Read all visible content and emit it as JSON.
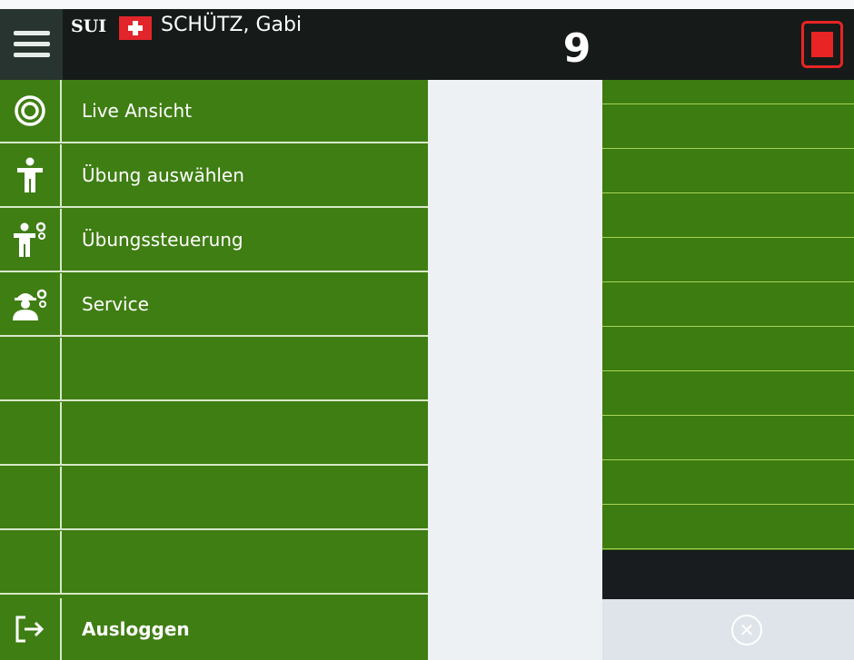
{
  "header": {
    "country_code": "SUI",
    "shooter_name": "SCHÜTZ, Gabi",
    "shot_count": "9"
  },
  "sidebar": {
    "items": [
      {
        "label": "Live Ansicht",
        "icon": "target-icon"
      },
      {
        "label": "Übung auswählen",
        "icon": "person-icon"
      },
      {
        "label": "Übungssteuerung",
        "icon": "person-gear-icon"
      },
      {
        "label": "Service",
        "icon": "worker-gear-icon"
      },
      {
        "label": ""
      },
      {
        "label": ""
      },
      {
        "label": ""
      },
      {
        "label": ""
      }
    ],
    "logout_label": "Ausloggen"
  },
  "colors": {
    "header_bg": "#161b1a",
    "sidebar_green": "#3f7e13",
    "stop_red": "#e82424",
    "flag_red": "#e2252b"
  }
}
